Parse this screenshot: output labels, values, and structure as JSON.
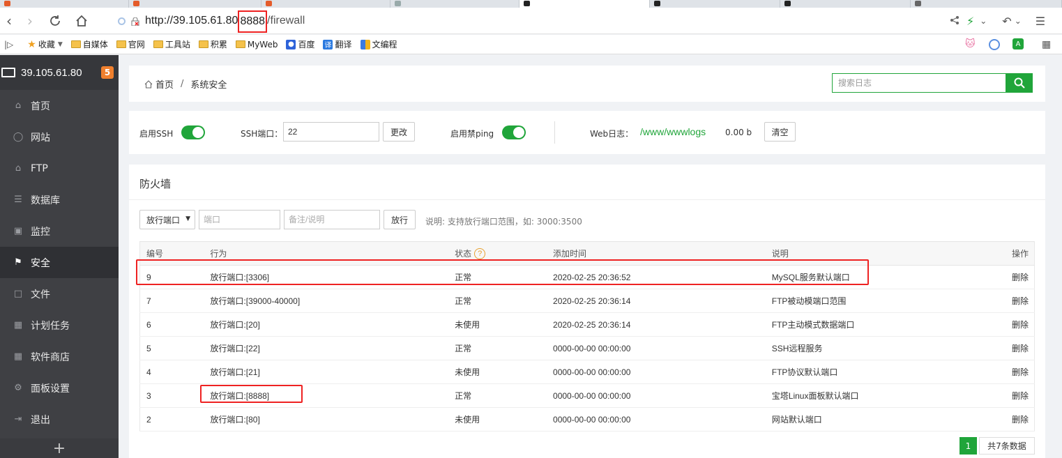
{
  "browser": {
    "url_host": "http://39.105.61.80",
    "url_port": "8888",
    "url_path": "/firewall",
    "bookmarks": [
      {
        "label": "收藏",
        "icon": "star-icon"
      },
      {
        "label": "自媒体",
        "icon": "folder-icon"
      },
      {
        "label": "官网",
        "icon": "folder-icon"
      },
      {
        "label": "工具站",
        "icon": "folder-icon"
      },
      {
        "label": "积累",
        "icon": "folder-icon"
      },
      {
        "label": "MyWeb",
        "icon": "folder-icon"
      },
      {
        "label": "百度",
        "icon": "baidu-icon"
      },
      {
        "label": "翻译",
        "icon": "translate-icon"
      },
      {
        "label": "文编程",
        "icon": "code-icon"
      }
    ]
  },
  "sidebar": {
    "server_ip": "39.105.61.80",
    "badge": "5",
    "items": [
      {
        "label": "首页",
        "icon": "home-icon"
      },
      {
        "label": "网站",
        "icon": "globe-icon"
      },
      {
        "label": "FTP",
        "icon": "ftp-icon"
      },
      {
        "label": "数据库",
        "icon": "database-icon"
      },
      {
        "label": "监控",
        "icon": "monitor-icon"
      },
      {
        "label": "安全",
        "icon": "shield-icon"
      },
      {
        "label": "文件",
        "icon": "folder-icon"
      },
      {
        "label": "计划任务",
        "icon": "calendar-icon"
      },
      {
        "label": "软件商店",
        "icon": "grid-icon"
      },
      {
        "label": "面板设置",
        "icon": "gear-icon"
      },
      {
        "label": "退出",
        "icon": "logout-icon"
      }
    ],
    "active_index": 5
  },
  "header": {
    "crumb_home": "首页",
    "crumb_sep": "/",
    "crumb_current": "系统安全",
    "search_placeholder": "搜索日志"
  },
  "settings": {
    "ssh_label": "启用SSH",
    "ssh_port_label": "SSH端口：",
    "ssh_port_value": "22",
    "change_btn": "更改",
    "ping_label": "启用禁ping",
    "weblog_label": "Web日志：",
    "weblog_path": "/www/wwwlogs",
    "weblog_size": "0.00 b",
    "clear_btn": "清空"
  },
  "firewall": {
    "title": "防火墙",
    "select_value": "放行端口",
    "port_placeholder": "端口",
    "note_placeholder": "备注/说明",
    "allow_btn": "放行",
    "hint": "说明: 支持放行端口范围，如: 3000:3500",
    "columns": [
      "编号",
      "行为",
      "状态",
      "添加时间",
      "说明",
      "操作"
    ],
    "status_help": "?",
    "rows": [
      {
        "id": "9",
        "action": "放行端口:[3306]",
        "status": "正常",
        "time": "2020-02-25 20:36:52",
        "desc": "MySQL服务默认端口",
        "op": "删除"
      },
      {
        "id": "7",
        "action": "放行端口:[39000-40000]",
        "status": "正常",
        "time": "2020-02-25 20:36:14",
        "desc": "FTP被动模端口范围",
        "op": "删除"
      },
      {
        "id": "6",
        "action": "放行端口:[20]",
        "status": "未使用",
        "time": "2020-02-25 20:36:14",
        "desc": "FTP主动模式数据端口",
        "op": "删除"
      },
      {
        "id": "5",
        "action": "放行端口:[22]",
        "status": "正常",
        "time": "0000-00-00 00:00:00",
        "desc": "SSH远程服务",
        "op": "删除"
      },
      {
        "id": "4",
        "action": "放行端口:[21]",
        "status": "未使用",
        "time": "0000-00-00 00:00:00",
        "desc": "FTP协议默认端口",
        "op": "删除"
      },
      {
        "id": "3",
        "action": "放行端口:[8888]",
        "status": "正常",
        "time": "0000-00-00 00:00:00",
        "desc": "宝塔Linux面板默认端口",
        "op": "删除"
      },
      {
        "id": "2",
        "action": "放行端口:[80]",
        "status": "未使用",
        "time": "0000-00-00 00:00:00",
        "desc": "网站默认端口",
        "op": "删除"
      }
    ],
    "page_current": "1",
    "page_total": "共7条数据"
  },
  "colors": {
    "accent": "#20a53a",
    "highlight": "#e22222",
    "sidebar_bg": "#3f4044",
    "badge": "#f0802e"
  }
}
